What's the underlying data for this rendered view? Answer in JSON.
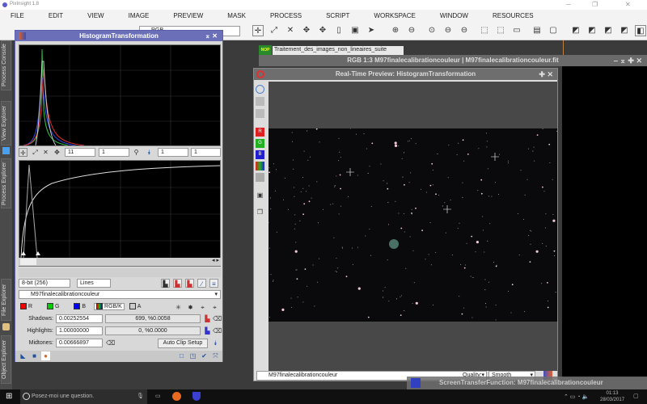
{
  "app": {
    "title": "PixInsight 1.8"
  },
  "menu": [
    "FILE",
    "EDIT",
    "VIEW",
    "IMAGE",
    "PREVIEW",
    "MASK",
    "PROCESS",
    "SCRIPT",
    "WORKSPACE",
    "WINDOW",
    "RESOURCES"
  ],
  "toolbar": {
    "view_select": "RGB"
  },
  "dock_tabs": [
    "Process Console",
    "View Explorer",
    "Process Explorer",
    "File Explorer",
    "Object Explorer"
  ],
  "hist": {
    "title": "HistogramTransformation",
    "zoom_h": "11",
    "zoom_v": "1",
    "zoom2_h": "1",
    "zoom2_v": "1",
    "bit_depth": "8-bit (256)",
    "plot_mode": "Lines",
    "view": "M97finalecalibrationcouleur",
    "channels": {
      "r": "R",
      "g": "G",
      "b": "B",
      "rgbk": "RGB/K",
      "a": "A"
    },
    "shadows_label": "Shadows:",
    "shadows": "0.00252554",
    "shadows_stat": "699, %0.0058",
    "highlights_label": "Highlights:",
    "highlights": "1.00000000",
    "highlights_stat": "0, %0.0000",
    "midtones_label": "Midtones:",
    "midtones": "0.00666897",
    "auto_clip": "Auto Clip Setup"
  },
  "background_icons": [
    "Traitement_des_images_non_lineaires_suite"
  ],
  "icon_badge": "NOP",
  "image_window": {
    "title": "RGB 1:3 M97finalecalibrationcouleur | M97finalecalibrationcouleur.fit"
  },
  "preview": {
    "title": "Real-Time Preview: HistogramTransformation",
    "view": "M97finalecalibrationcouleur",
    "quality_label": "Quality:",
    "quality": "Smooth"
  },
  "stf": {
    "title": "ScreenTransferFunction: M97finalecalibrationcouleur"
  },
  "taskbar": {
    "search": "Posez-moi une question.",
    "time": "01:13",
    "date": "28/03/2017"
  },
  "colors": {
    "hist_title": "#6a6fb8",
    "workspace": "#3b3b3b"
  }
}
